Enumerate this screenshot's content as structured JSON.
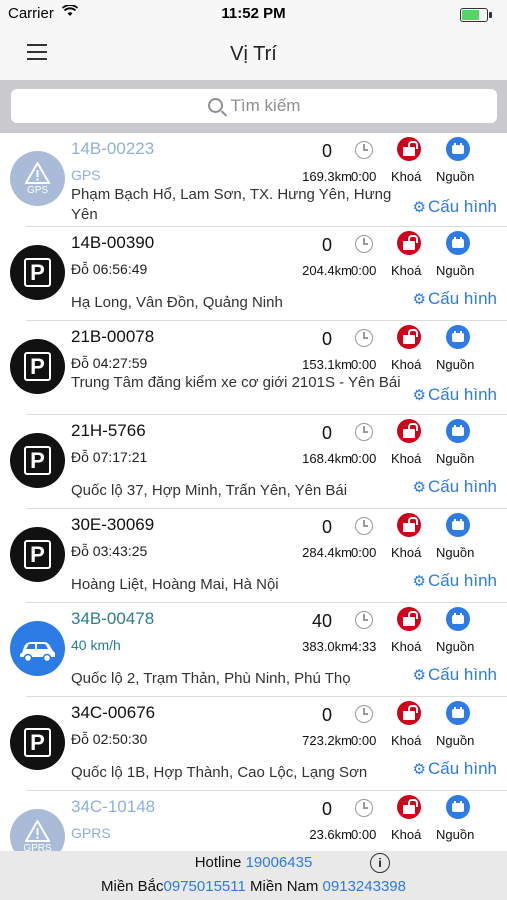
{
  "status_bar": {
    "carrier": "Carrier",
    "time": "11:52 PM"
  },
  "nav": {
    "title": "Vị Trí",
    "menu_icon": "hamburger-icon"
  },
  "search": {
    "placeholder": "Tìm kiếm"
  },
  "rows": [
    {
      "plate": "14B-00223",
      "status": "GPS",
      "speed": "0",
      "distance": "169.3km",
      "duration": "0:00",
      "lock_label": "Khoá",
      "power_label": "Nguồn",
      "address": "Phạm Bạch Hổ, Lam Sơn, TX. Hưng Yên, Hưng Yên",
      "config_label": "Cấu hình",
      "avatar": "gps",
      "avatar_text": "GPS"
    },
    {
      "plate": "14B-00390",
      "status": "Đỗ 06:56:49",
      "speed": "0",
      "distance": "204.4km",
      "duration": "0:00",
      "lock_label": "Khoá",
      "power_label": "Nguồn",
      "address": "Hạ Long, Vân Đồn, Quảng Ninh",
      "config_label": "Cấu hình",
      "avatar": "parking",
      "avatar_text": "P"
    },
    {
      "plate": "21B-00078",
      "status": "Đỗ 04:27:59",
      "speed": "0",
      "distance": "153.1km",
      "duration": "0:00",
      "lock_label": "Khoá",
      "power_label": "Nguồn",
      "address": "Trung Tâm đăng kiểm xe cơ giới 2101S - Yên Bái",
      "config_label": "Cấu hình",
      "avatar": "parking",
      "avatar_text": "P"
    },
    {
      "plate": "21H-5766",
      "status": "Đỗ 07:17:21",
      "speed": "0",
      "distance": "168.4km",
      "duration": "0:00",
      "lock_label": "Khoá",
      "power_label": "Nguồn",
      "address": "Quốc lộ 37, Hợp Minh, Trấn Yên, Yên Bái",
      "config_label": "Cấu hình",
      "avatar": "parking",
      "avatar_text": "P"
    },
    {
      "plate": "30E-30069",
      "status": "Đỗ 03:43:25",
      "speed": "0",
      "distance": "284.4km",
      "duration": "0:00",
      "lock_label": "Khoá",
      "power_label": "Nguồn",
      "address": "Hoàng Liệt, Hoàng Mai, Hà Nội",
      "config_label": "Cấu hình",
      "avatar": "parking",
      "avatar_text": "P"
    },
    {
      "plate": "34B-00478",
      "status": "40 km/h",
      "speed": "40",
      "distance": "383.0km",
      "duration": "4:33",
      "lock_label": "Khoá",
      "power_label": "Nguồn",
      "address": "Quốc lộ 2, Trạm Thản, Phù Ninh, Phú Thọ",
      "config_label": "Cấu hình",
      "avatar": "car",
      "avatar_text": ""
    },
    {
      "plate": "34C-00676",
      "status": "Đỗ 02:50:30",
      "speed": "0",
      "distance": "723.2km",
      "duration": "0:00",
      "lock_label": "Khoá",
      "power_label": "Nguồn",
      "address": "Quốc lộ 1B, Hợp Thành, Cao Lộc, Lạng Sơn",
      "config_label": "Cấu hình",
      "avatar": "parking",
      "avatar_text": "P"
    },
    {
      "plate": "34C-10148",
      "status": "GPRS",
      "speed": "0",
      "distance": "23.6km",
      "duration": "0:00",
      "lock_label": "Khoá",
      "power_label": "Nguồn",
      "address": "",
      "config_label": "",
      "avatar": "gps",
      "avatar_text": "GPRS"
    }
  ],
  "footer": {
    "hotline_label": "Hotline",
    "hotline_number": "19006435",
    "north_label": "Miền Bắc",
    "north_number": "0975015511",
    "south_label": "Miền Nam",
    "south_number": "0913243398"
  },
  "colors": {
    "accent": "#2d7be5",
    "lock": "#d0021b",
    "offline": "#8fb1d8",
    "moving": "#2b7d8f"
  }
}
